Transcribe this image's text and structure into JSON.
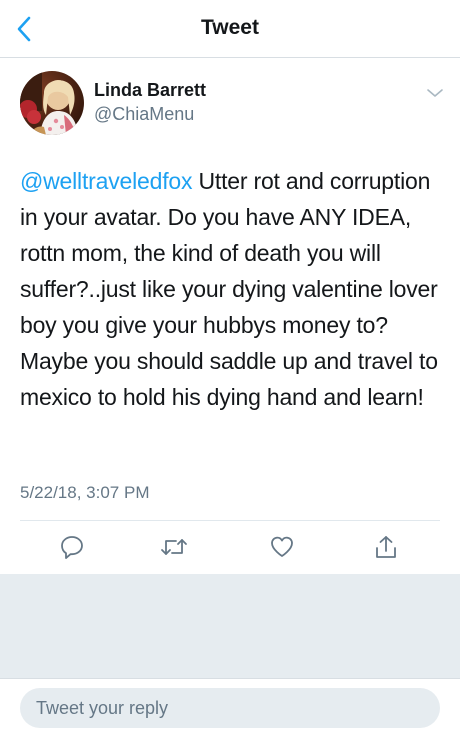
{
  "header": {
    "title": "Tweet",
    "back_icon": "chevron-left-icon"
  },
  "tweet": {
    "author_name": "Linda Barrett",
    "author_handle": "@ChiaMenu",
    "mention": "@welltraveledfox",
    "text": " Utter rot and corruption in your avatar. Do you have ANY IDEA, rottn mom, the kind of death you will suffer?..just like your dying valentine lover boy you give your hubbys money to? Maybe you should saddle up and travel to mexico to hold his dying hand and learn!",
    "timestamp": "5/22/18, 3:07 PM"
  },
  "actions": {
    "reply_icon": "reply-icon",
    "retweet_icon": "retweet-icon",
    "like_icon": "heart-icon",
    "share_icon": "share-icon"
  },
  "reply": {
    "placeholder": "Tweet your reply"
  },
  "colors": {
    "accent": "#1da1f2",
    "text_primary": "#14171a",
    "text_secondary": "#657786",
    "background_gray": "#e6ecf0"
  }
}
